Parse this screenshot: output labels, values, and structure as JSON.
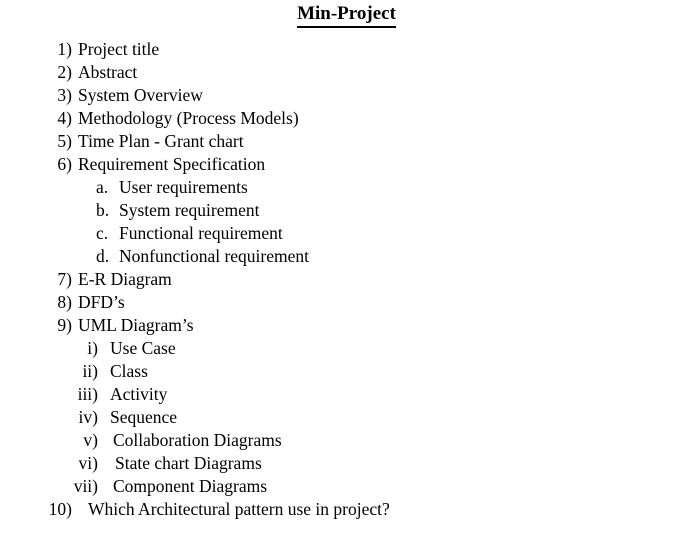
{
  "document": {
    "title": "Min-Project",
    "background_color": "#ffffff",
    "text_color": "#000000"
  },
  "outline": [
    {
      "marker": "1)",
      "label": "Project title"
    },
    {
      "marker": "2)",
      "label": "Abstract"
    },
    {
      "marker": "3)",
      "label": "System Overview"
    },
    {
      "marker": "4)",
      "label": "Methodology (Process Models)"
    },
    {
      "marker": "5)",
      "label": "Time Plan - Grant chart"
    },
    {
      "marker": "6)",
      "label": "Requirement Specification"
    },
    {
      "marker": "a.",
      "label": "User requirements"
    },
    {
      "marker": "b.",
      "label": "System requirement"
    },
    {
      "marker": "c.",
      "label": "Functional requirement"
    },
    {
      "marker": "d.",
      "label": "Nonfunctional requirement"
    },
    {
      "marker": "7)",
      "label": "E-R Diagram"
    },
    {
      "marker": "8)",
      "label": "DFD’s"
    },
    {
      "marker": "9)",
      "label": "UML Diagram’s"
    },
    {
      "marker": "i)",
      "label": "Use Case"
    },
    {
      "marker": "ii)",
      "label": "Class"
    },
    {
      "marker": "iii)",
      "label": "Activity"
    },
    {
      "marker": "iv)",
      "label": "Sequence"
    },
    {
      "marker": "v)",
      "label": "Collaboration Diagrams"
    },
    {
      "marker": "vi)",
      "label": "State chart Diagrams"
    },
    {
      "marker": "vii)",
      "label": "Component Diagrams"
    },
    {
      "marker": "10)",
      "label": "Which Architectural pattern use in project?"
    }
  ]
}
